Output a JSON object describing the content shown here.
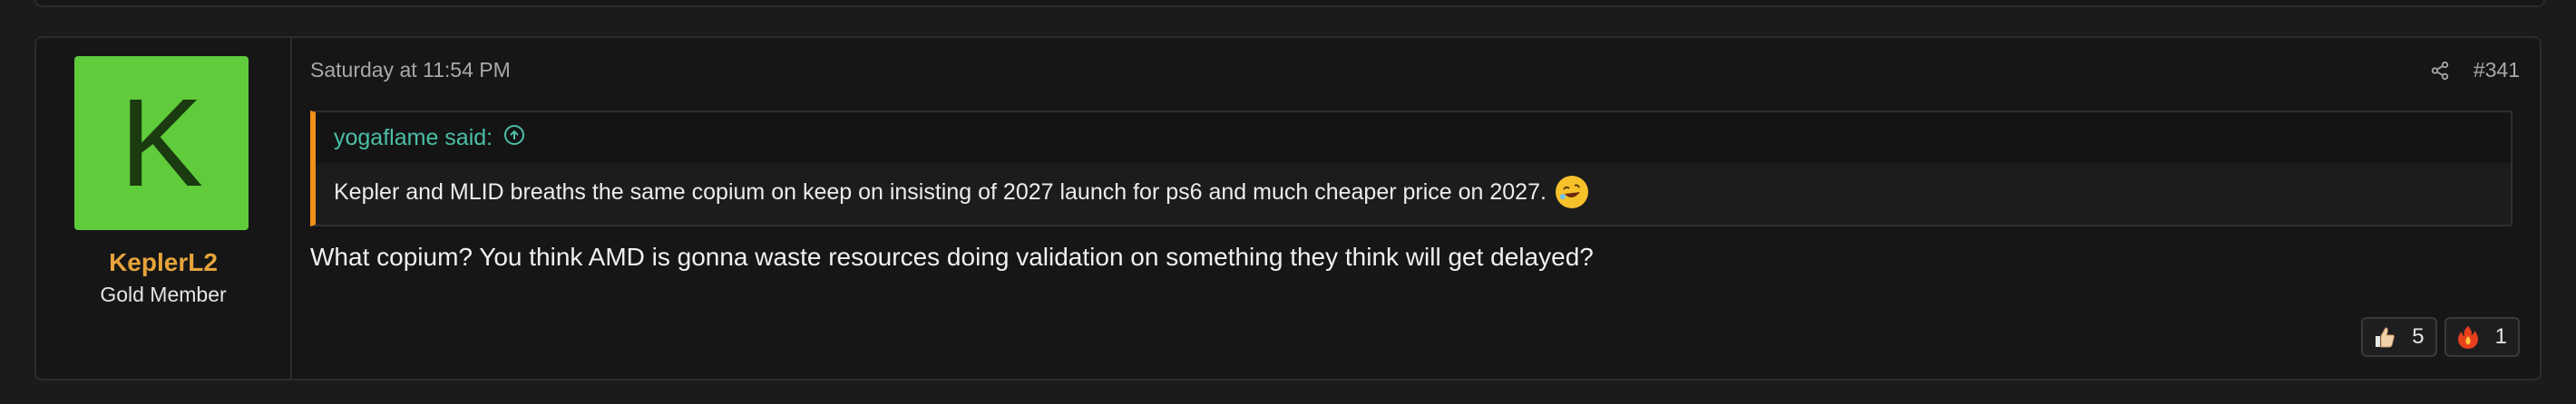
{
  "post": {
    "user": {
      "avatar_letter": "K",
      "avatar_color": "#60cc3c",
      "username": "KeplerL2",
      "username_color": "#e7a43b",
      "title": "Gold Member"
    },
    "timestamp": "Saturday at 11:54 PM",
    "post_number": "#341",
    "share_icon": "share-icon",
    "quote": {
      "author_said": "yogaflame said:",
      "jump_icon": "arrow-up-circle-icon",
      "text": "Kepler and MLID breaths the same copium on keep on insisting of 2027 launch for ps6 and much cheaper price on 2027.",
      "emoji": "rolling-on-floor-laughing-emoji",
      "accent_color": "#f0901a",
      "author_color": "#4bbfa6"
    },
    "message": "What copium? You think AMD is gonna waste resources doing validation on something they think will get delayed?",
    "reactions": [
      {
        "icon": "thumbs-up-icon",
        "count": "5"
      },
      {
        "icon": "fire-icon",
        "count": "1"
      }
    ]
  }
}
